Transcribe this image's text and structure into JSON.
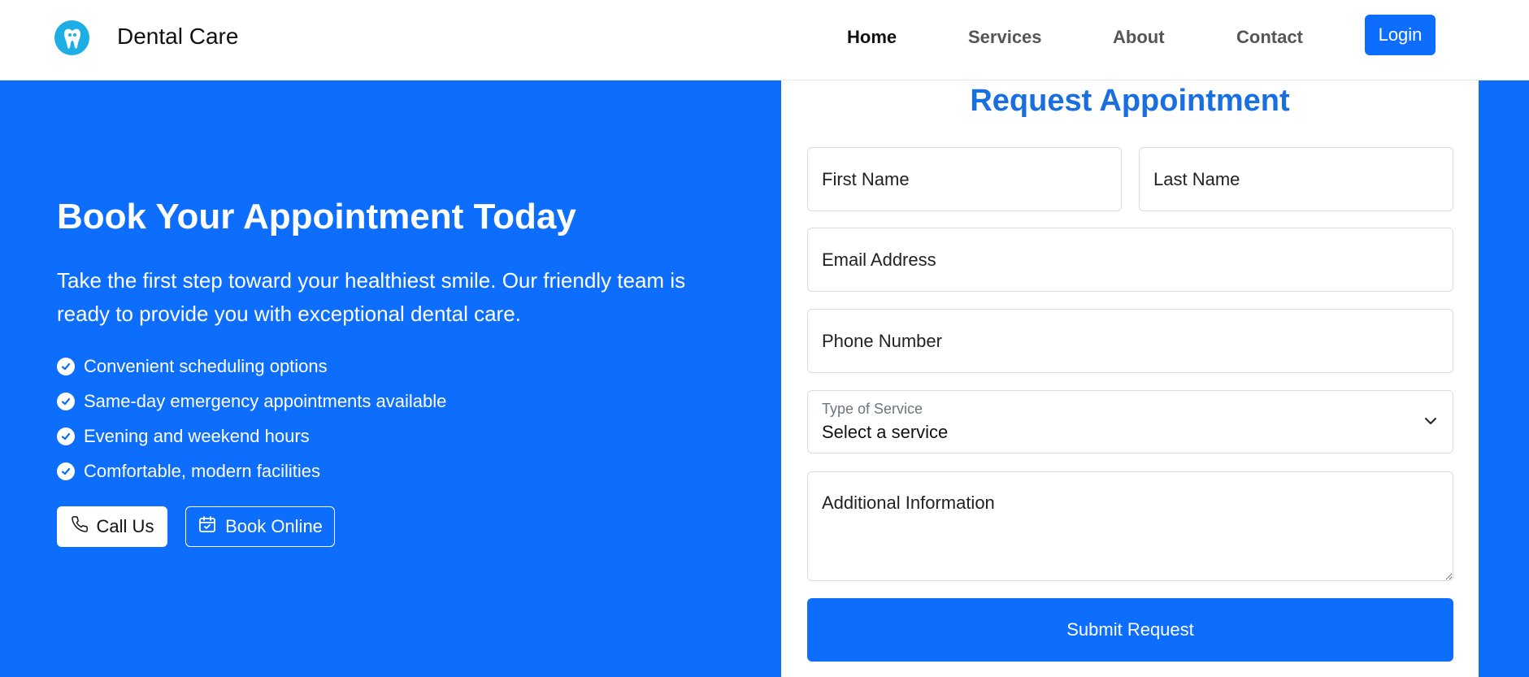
{
  "header": {
    "brand": "Dental Care",
    "logo_icon": "tooth-icon",
    "nav": [
      {
        "label": "Home",
        "active": true
      },
      {
        "label": "Services",
        "active": false
      },
      {
        "label": "About",
        "active": false
      },
      {
        "label": "Contact",
        "active": false
      }
    ],
    "login_label": "Login"
  },
  "hero": {
    "title": "Book Your Appointment Today",
    "description": "Take the first step toward your healthiest smile. Our friendly team is ready to provide you with exceptional dental care.",
    "features": [
      "Convenient scheduling options",
      "Same-day emergency appointments available",
      "Evening and weekend hours",
      "Comfortable, modern facilities"
    ],
    "call_label": "Call Us",
    "call_icon": "phone-icon",
    "book_label": "Book Online",
    "book_icon": "calendar-check-icon"
  },
  "form": {
    "title": "Request Appointment",
    "first_name_placeholder": "First Name",
    "last_name_placeholder": "Last Name",
    "email_placeholder": "Email Address",
    "phone_placeholder": "Phone Number",
    "service_label": "Type of Service",
    "service_value": "Select a service",
    "notes_placeholder": "Additional Information",
    "submit_label": "Submit Request"
  },
  "colors": {
    "primary": "#0d6efd",
    "title_blue": "#1a6fe0",
    "logo_badge": "#1eaee6"
  }
}
